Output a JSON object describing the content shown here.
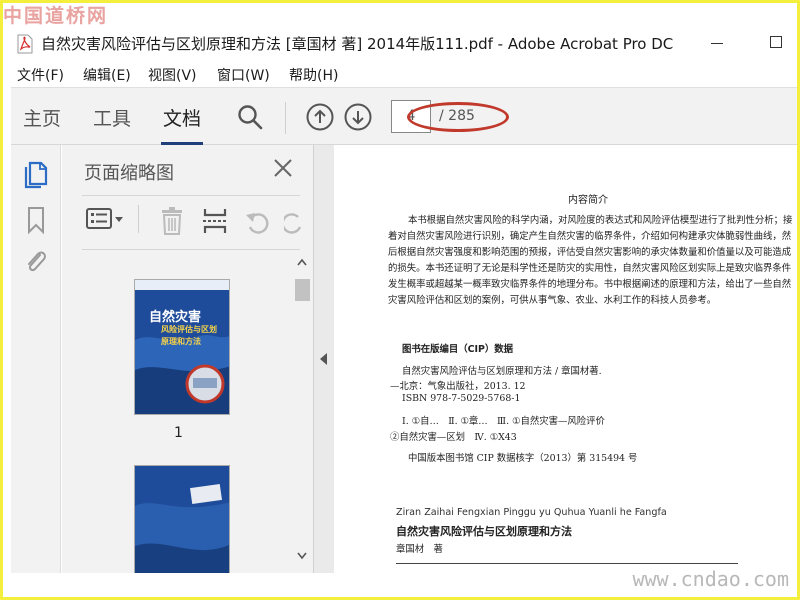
{
  "watermarks": {
    "top": "中国道桥网",
    "bottom": "www.cndao.com"
  },
  "window": {
    "title": "自然灾害风险评估与区划原理和方法 [章国材 著] 2014年版111.pdf - Adobe Acrobat Pro DC"
  },
  "menu": [
    "文件(F)",
    "编辑(E)",
    "视图(V)",
    "窗口(W)",
    "帮助(H)"
  ],
  "toolbar": {
    "tabs": [
      "主页",
      "工具",
      "文档"
    ],
    "active_tab": "文档",
    "page_input_value": "4",
    "page_total": "/ 285"
  },
  "thumbnails_panel": {
    "title": "页面缩略图",
    "thumbnails": [
      {
        "label": "1",
        "cover_title": "自然灾害",
        "cover_subtitle_1": "风险评估与区划",
        "cover_subtitle_2": "原理和方法"
      }
    ]
  },
  "document": {
    "heading": "内容简介",
    "paragraph": "本书根据自然灾害风险的科学内涵，对风险度的表达式和风险评估模型进行了批判性分析；接着对自然灾害风险进行识别，确定产生自然灾害的临界条件，介绍如何构建承灾体脆弱性曲线，然后根据自然灾害强度和影响范围的预报，评估受自然灾害影响的承灾体数量和价值量以及可能造成的损失。本书还证明了无论是科学性还是防灾的实用性，自然灾害风险区划实际上是致灾临界条件发生概率或超越某一概率致灾临界条件的地理分布。书中根据阐述的原理和方法，给出了一些自然灾害风险评估和区划的案例，可供从事气象、农业、水利工作的科技人员参考。",
    "cip_heading": "图书在版编目（CIP）数据",
    "cip_lines": [
      "自然灾害风险评估与区划原理和方法 / 章国材著.",
      "—北京：气象出版社，2013. 12",
      "ISBN 978-7-5029-5768-1",
      "Ⅰ. ①自…　Ⅱ. ①章…　Ⅲ. ①自然灾害—风险评价",
      "②自然灾害—区划　Ⅳ. ①X43",
      "中国版本图书馆 CIP 数据核字（2013）第 315494 号"
    ],
    "pinyin_title": "Ziran Zaihai Fengxian Pinggu yu Quhua Yuanli he Fangfa",
    "book_title": "自然灾害风险评估与区划原理和方法",
    "author": "章国材　著"
  },
  "colors": {
    "frame": "#f4ef3c",
    "tab_underline": "#1e3f7a",
    "rail_active_icon": "#2b6cc4",
    "annotation_ellipse": "#c0392b",
    "thumb_cover": "#1e4c9a"
  }
}
